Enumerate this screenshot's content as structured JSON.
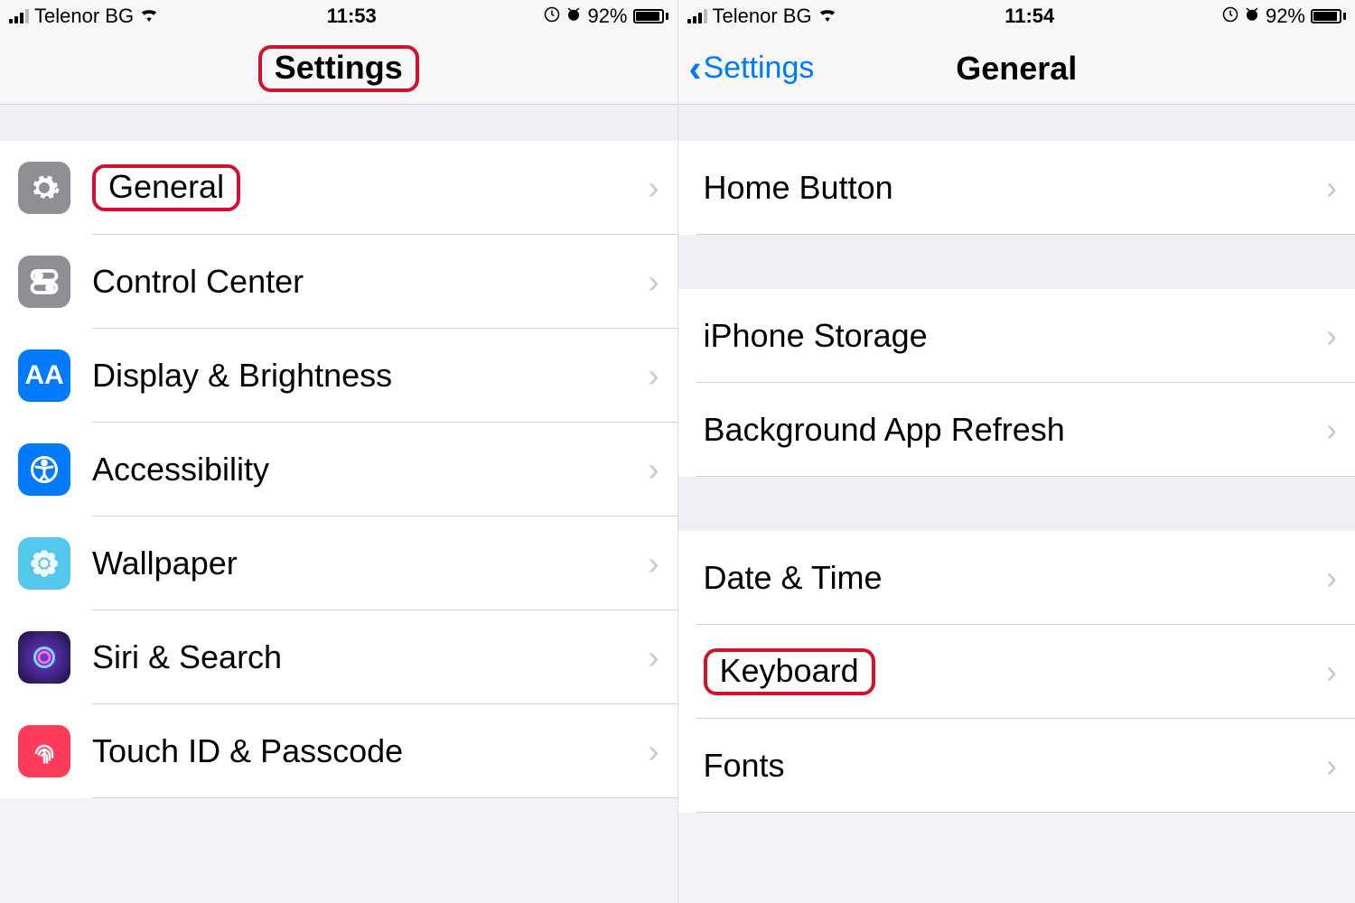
{
  "left": {
    "status": {
      "carrier": "Telenor BG",
      "time": "11:53",
      "battery": "92%"
    },
    "nav": {
      "title": "Settings"
    },
    "rows": [
      {
        "label": "General"
      },
      {
        "label": "Control Center"
      },
      {
        "label": "Display & Brightness"
      },
      {
        "label": "Accessibility"
      },
      {
        "label": "Wallpaper"
      },
      {
        "label": "Siri & Search"
      },
      {
        "label": "Touch ID & Passcode"
      }
    ]
  },
  "right": {
    "status": {
      "carrier": "Telenor BG",
      "time": "11:54",
      "battery": "92%"
    },
    "nav": {
      "back": "Settings",
      "title": "General"
    },
    "group1": [
      {
        "label": "Home Button"
      }
    ],
    "group2": [
      {
        "label": "iPhone Storage"
      },
      {
        "label": "Background App Refresh"
      }
    ],
    "group3": [
      {
        "label": "Date & Time"
      },
      {
        "label": "Keyboard"
      },
      {
        "label": "Fonts"
      }
    ]
  }
}
